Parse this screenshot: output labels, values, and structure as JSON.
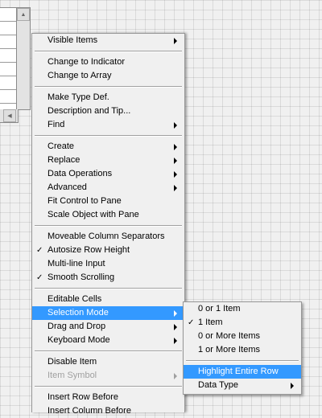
{
  "context_menu": {
    "groups": [
      [
        {
          "label": "Visible Items",
          "submenu": true
        }
      ],
      [
        {
          "label": "Change to Indicator"
        },
        {
          "label": "Change to Array"
        }
      ],
      [
        {
          "label": "Make Type Def."
        },
        {
          "label": "Description and Tip..."
        },
        {
          "label": "Find",
          "submenu": true
        }
      ],
      [
        {
          "label": "Create",
          "submenu": true
        },
        {
          "label": "Replace",
          "submenu": true
        },
        {
          "label": "Data Operations",
          "submenu": true
        },
        {
          "label": "Advanced",
          "submenu": true
        },
        {
          "label": "Fit Control to Pane"
        },
        {
          "label": "Scale Object with Pane"
        }
      ],
      [
        {
          "label": "Moveable Column Separators"
        },
        {
          "label": "Autosize Row Height",
          "checked": true
        },
        {
          "label": "Multi-line Input"
        },
        {
          "label": "Smooth Scrolling",
          "checked": true
        }
      ],
      [
        {
          "label": "Editable Cells"
        },
        {
          "label": "Selection Mode",
          "submenu": true,
          "highlighted": true
        },
        {
          "label": "Drag and Drop",
          "submenu": true
        },
        {
          "label": "Keyboard Mode",
          "submenu": true
        }
      ],
      [
        {
          "label": "Disable Item"
        },
        {
          "label": "Item Symbol",
          "submenu": true,
          "disabled": true
        }
      ],
      [
        {
          "label": "Insert Row Before"
        },
        {
          "label": "Insert Column Before"
        }
      ]
    ]
  },
  "selection_mode_submenu": {
    "groups": [
      [
        {
          "label": "0 or 1 Item"
        },
        {
          "label": "1 Item",
          "checked": true
        },
        {
          "label": "0 or More Items"
        },
        {
          "label": "1 or More Items"
        }
      ],
      [
        {
          "label": "Highlight Entire Row",
          "highlighted": true
        },
        {
          "label": "Data Type",
          "submenu": true
        }
      ]
    ]
  },
  "glyphs": {
    "check": "✓",
    "scroll_up": "▲",
    "scroll_left": "◀"
  },
  "colors": {
    "highlight": "#3399ff",
    "menu_bg": "#f0f0f0",
    "disabled_text": "#a0a0a0"
  }
}
